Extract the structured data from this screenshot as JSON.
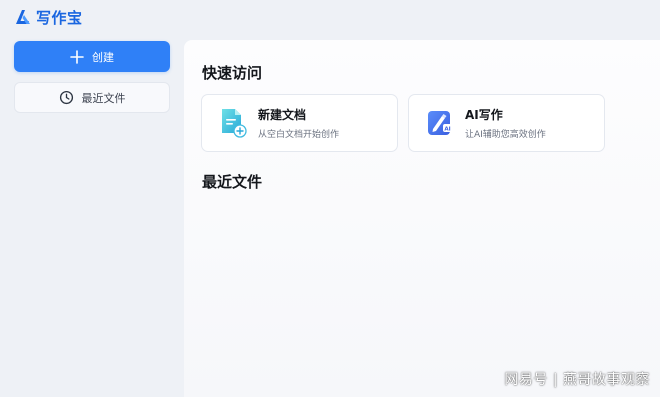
{
  "app": {
    "name": "写作宝",
    "brand_color": "#1a66e0"
  },
  "sidebar": {
    "create_label": "创建",
    "recent_label": "最近文件"
  },
  "main": {
    "quick_access_title": "快速访问",
    "cards": [
      {
        "title": "新建文档",
        "subtitle": "从空白文档开始创作",
        "icon": "new-document-icon"
      },
      {
        "title": "AI写作",
        "subtitle": "让AI辅助您高效创作",
        "icon": "ai-writing-icon"
      }
    ],
    "recent_files_title": "最近文件"
  },
  "colors": {
    "primary_button": "#2f80f7",
    "background": "#eef1f6"
  },
  "watermark": "网易号 | 燕哥故事观察"
}
